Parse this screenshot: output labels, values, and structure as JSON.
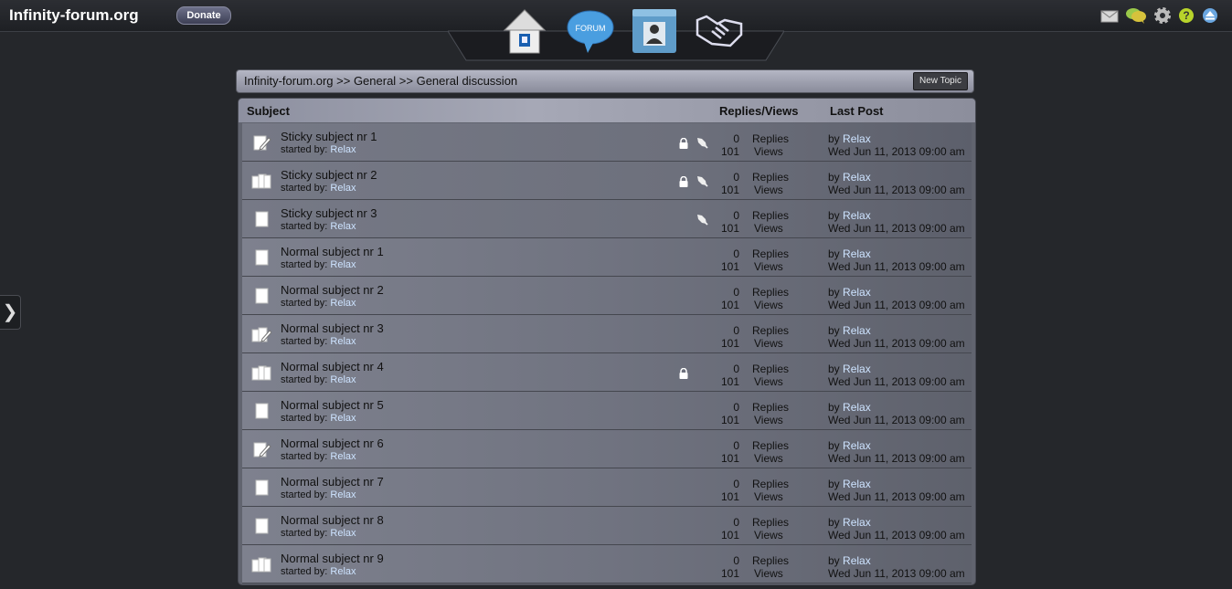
{
  "header": {
    "site_title": "Infinity-forum.org",
    "donate_label": "Donate",
    "right_icons": [
      "mail-icon",
      "chat-icon",
      "gear-icon",
      "help-icon",
      "eject-icon"
    ],
    "nav_icons": [
      "home-icon",
      "forum-icon",
      "profile-icon",
      "handshake-icon"
    ],
    "forum_icon_text": "FORUM"
  },
  "sidebar": {
    "toggle_label": "❯"
  },
  "breadcrumb": {
    "text": "Infinity-forum.org >> General >> General discussion",
    "new_topic_label": "New Topic"
  },
  "table": {
    "columns": [
      "Subject",
      "Replies/Views",
      "Last Post"
    ],
    "started_by_label": "started by:",
    "replies_label": "Replies",
    "views_label": "Views",
    "by_label": "by",
    "rows": [
      {
        "title": "Sticky subject nr 1",
        "author": "Relax",
        "replies": "0",
        "views": "101",
        "last_by": "Relax",
        "last_date": "Wed Jun 11, 2013 09:00 am",
        "type": "sticky",
        "icon": "edit-icon",
        "lock": true,
        "pin": true
      },
      {
        "title": "Sticky subject nr 2",
        "author": "Relax",
        "replies": "0",
        "views": "101",
        "last_by": "Relax",
        "last_date": "Wed Jun 11, 2013 09:00 am",
        "type": "sticky",
        "icon": "multi-page-icon",
        "lock": true,
        "pin": true
      },
      {
        "title": "Sticky subject nr 3",
        "author": "Relax",
        "replies": "0",
        "views": "101",
        "last_by": "Relax",
        "last_date": "Wed Jun 11, 2013 09:00 am",
        "type": "sticky",
        "icon": "page-icon",
        "lock": false,
        "pin": true
      },
      {
        "title": "Normal subject nr 1",
        "author": "Relax",
        "replies": "0",
        "views": "101",
        "last_by": "Relax",
        "last_date": "Wed Jun 11, 2013 09:00 am",
        "type": "normal",
        "icon": "page-icon",
        "lock": false,
        "pin": false
      },
      {
        "title": "Normal subject nr 2",
        "author": "Relax",
        "replies": "0",
        "views": "101",
        "last_by": "Relax",
        "last_date": "Wed Jun 11, 2013 09:00 am",
        "type": "normal",
        "icon": "page-icon",
        "lock": false,
        "pin": false
      },
      {
        "title": "Normal subject nr 3",
        "author": "Relax",
        "replies": "0",
        "views": "101",
        "last_by": "Relax",
        "last_date": "Wed Jun 11, 2013 09:00 am",
        "type": "normal",
        "icon": "multi-edit-icon",
        "lock": false,
        "pin": false
      },
      {
        "title": "Normal subject nr 4",
        "author": "Relax",
        "replies": "0",
        "views": "101",
        "last_by": "Relax",
        "last_date": "Wed Jun 11, 2013 09:00 am",
        "type": "normal",
        "icon": "multi-page-icon",
        "lock": true,
        "pin": false
      },
      {
        "title": "Normal subject nr 5",
        "author": "Relax",
        "replies": "0",
        "views": "101",
        "last_by": "Relax",
        "last_date": "Wed Jun 11, 2013 09:00 am",
        "type": "normal",
        "icon": "page-icon",
        "lock": false,
        "pin": false
      },
      {
        "title": "Normal subject nr 6",
        "author": "Relax",
        "replies": "0",
        "views": "101",
        "last_by": "Relax",
        "last_date": "Wed Jun 11, 2013 09:00 am",
        "type": "normal",
        "icon": "edit-icon",
        "lock": false,
        "pin": false
      },
      {
        "title": "Normal subject nr 7",
        "author": "Relax",
        "replies": "0",
        "views": "101",
        "last_by": "Relax",
        "last_date": "Wed Jun 11, 2013 09:00 am",
        "type": "normal",
        "icon": "page-icon",
        "lock": false,
        "pin": false
      },
      {
        "title": "Normal subject nr 8",
        "author": "Relax",
        "replies": "0",
        "views": "101",
        "last_by": "Relax",
        "last_date": "Wed Jun 11, 2013 09:00 am",
        "type": "normal",
        "icon": "page-icon",
        "lock": false,
        "pin": false
      },
      {
        "title": "Normal subject nr 9",
        "author": "Relax",
        "replies": "0",
        "views": "101",
        "last_by": "Relax",
        "last_date": "Wed Jun 11, 2013 09:00 am",
        "type": "normal",
        "icon": "multi-page-icon",
        "lock": false,
        "pin": false
      }
    ]
  }
}
